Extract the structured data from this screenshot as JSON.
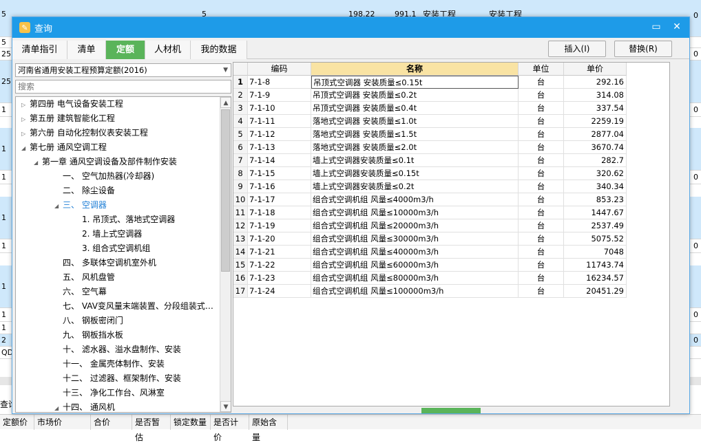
{
  "background": {
    "top_row": {
      "c1": "5",
      "c2": "5",
      "c3": "198.22",
      "c4": "991.1",
      "c5": "安装工程",
      "c6": "安装工程",
      "c7": "0"
    },
    "rows": [
      {
        "left": "5",
        "right": ""
      },
      {
        "left": "25",
        "right": "0"
      },
      {
        "left": "25",
        "right": ""
      },
      {
        "left": "1",
        "right": "0"
      },
      {
        "left": "1",
        "right": ""
      },
      {
        "left": "1",
        "right": "0"
      },
      {
        "left": "1",
        "right": ""
      },
      {
        "left": "1",
        "right": "0"
      },
      {
        "left": "1",
        "right": ""
      },
      {
        "left": "1",
        "right": "0"
      },
      {
        "left": "1",
        "right": ""
      },
      {
        "left": "2",
        "right": "0"
      },
      {
        "left": "QD",
        "right": ""
      }
    ],
    "search_label": "查询",
    "footer_cols": [
      "定额价",
      "市场价",
      "合价",
      "是否暂估",
      "锁定数量",
      "是否计价",
      "原始含量"
    ]
  },
  "dialog": {
    "title": "查询",
    "title_icon": "app-icon",
    "minimize_icon": "minimize-icon",
    "close_icon": "close-icon",
    "tabs": [
      {
        "label": "清单指引",
        "active": false
      },
      {
        "label": "清单",
        "active": false
      },
      {
        "label": "定额",
        "active": true
      },
      {
        "label": "人材机",
        "active": false
      },
      {
        "label": "我的数据",
        "active": false
      }
    ],
    "insert_label": "插入(I)",
    "replace_label": "替换(R)"
  },
  "left": {
    "quota_selected": "河南省通用安装工程预算定额(2016)",
    "search_placeholder": "搜索",
    "tree": [
      {
        "label": "第四册 电气设备安装工程",
        "level": 0,
        "toggle": "collapsed"
      },
      {
        "label": "第五册 建筑智能化工程",
        "level": 0,
        "toggle": "collapsed"
      },
      {
        "label": "第六册 自动化控制仪表安装工程",
        "level": 0,
        "toggle": "collapsed"
      },
      {
        "label": "第七册 通风空调工程",
        "level": 0,
        "toggle": "expanded"
      },
      {
        "label": "第一章 通风空调设备及部件制作安装",
        "level": 1,
        "toggle": "expanded"
      },
      {
        "label": "一、 空气加热器(冷却器)",
        "level": 2,
        "toggle": "none"
      },
      {
        "label": "二、 除尘设备",
        "level": 2,
        "toggle": "none"
      },
      {
        "label": "三、 空调器",
        "level": 2,
        "toggle": "expanded",
        "selected": true
      },
      {
        "label": "1. 吊顶式、落地式空调器",
        "level": 3,
        "toggle": "none"
      },
      {
        "label": "2. 墙上式空调器",
        "level": 3,
        "toggle": "none"
      },
      {
        "label": "3. 组合式空调机组",
        "level": 3,
        "toggle": "none"
      },
      {
        "label": "四、 多联体空调机室外机",
        "level": 2,
        "toggle": "none"
      },
      {
        "label": "五、 风机盘管",
        "level": 2,
        "toggle": "none"
      },
      {
        "label": "六、 空气幕",
        "level": 2,
        "toggle": "none"
      },
      {
        "label": "七、 VAV变风量末端装置、分段组装式…",
        "level": 2,
        "toggle": "none"
      },
      {
        "label": "八、 钢板密闭门",
        "level": 2,
        "toggle": "none"
      },
      {
        "label": "九、 钢板挡水板",
        "level": 2,
        "toggle": "none"
      },
      {
        "label": "十、 滤水器、溢水盘制作、安装",
        "level": 2,
        "toggle": "none"
      },
      {
        "label": "十一、 金属壳体制作、安装",
        "level": 2,
        "toggle": "none"
      },
      {
        "label": "十二、 过滤器、框架制作、安装",
        "level": 2,
        "toggle": "none"
      },
      {
        "label": "十三、 净化工作台、风淋室",
        "level": 2,
        "toggle": "none"
      },
      {
        "label": "十四、 通风机",
        "level": 2,
        "toggle": "expanded"
      }
    ]
  },
  "grid": {
    "headers": {
      "code": "编码",
      "name": "名称",
      "unit": "单位",
      "price": "单价"
    },
    "rows": [
      {
        "idx": "1",
        "code": "7-1-8",
        "name": "吊顶式空调器 安装质量≤0.15t",
        "unit": "台",
        "price": "292.16"
      },
      {
        "idx": "2",
        "code": "7-1-9",
        "name": "吊顶式空调器 安装质量≤0.2t",
        "unit": "台",
        "price": "314.08"
      },
      {
        "idx": "3",
        "code": "7-1-10",
        "name": "吊顶式空调器 安装质量≤0.4t",
        "unit": "台",
        "price": "337.54"
      },
      {
        "idx": "4",
        "code": "7-1-11",
        "name": "落地式空调器 安装质量≤1.0t",
        "unit": "台",
        "price": "2259.19"
      },
      {
        "idx": "5",
        "code": "7-1-12",
        "name": "落地式空调器 安装质量≤1.5t",
        "unit": "台",
        "price": "2877.04"
      },
      {
        "idx": "6",
        "code": "7-1-13",
        "name": "落地式空调器 安装质量≤2.0t",
        "unit": "台",
        "price": "3670.74"
      },
      {
        "idx": "7",
        "code": "7-1-14",
        "name": "墙上式空调器安装质量≤0.1t",
        "unit": "台",
        "price": "282.7"
      },
      {
        "idx": "8",
        "code": "7-1-15",
        "name": "墙上式空调器安装质量≤0.15t",
        "unit": "台",
        "price": "320.62"
      },
      {
        "idx": "9",
        "code": "7-1-16",
        "name": "墙上式空调器安装质量≤0.2t",
        "unit": "台",
        "price": "340.34"
      },
      {
        "idx": "10",
        "code": "7-1-17",
        "name": "组合式空调机组 风量≤4000m3/h",
        "unit": "台",
        "price": "853.23"
      },
      {
        "idx": "11",
        "code": "7-1-18",
        "name": "组合式空调机组 风量≤10000m3/h",
        "unit": "台",
        "price": "1447.67"
      },
      {
        "idx": "12",
        "code": "7-1-19",
        "name": "组合式空调机组 风量≤20000m3/h",
        "unit": "台",
        "price": "2537.49"
      },
      {
        "idx": "13",
        "code": "7-1-20",
        "name": "组合式空调机组 风量≤30000m3/h",
        "unit": "台",
        "price": "5075.52"
      },
      {
        "idx": "14",
        "code": "7-1-21",
        "name": "组合式空调机组 风量≤40000m3/h",
        "unit": "台",
        "price": "7048"
      },
      {
        "idx": "15",
        "code": "7-1-22",
        "name": "组合式空调机组 风量≤60000m3/h",
        "unit": "台",
        "price": "11743.74"
      },
      {
        "idx": "16",
        "code": "7-1-23",
        "name": "组合式空调机组 风量≤80000m3/h",
        "unit": "台",
        "price": "16234.57"
      },
      {
        "idx": "17",
        "code": "7-1-24",
        "name": "组合式空调机组 风量≤100000m3/h",
        "unit": "台",
        "price": "20451.29"
      }
    ]
  },
  "colors": {
    "title_bar": "#1e9be8",
    "active_tab": "#5ab45a",
    "name_header": "#f9e3a3",
    "selected_tree": "#1f7fd6",
    "bg_row_blue": "#cfe8fb"
  }
}
